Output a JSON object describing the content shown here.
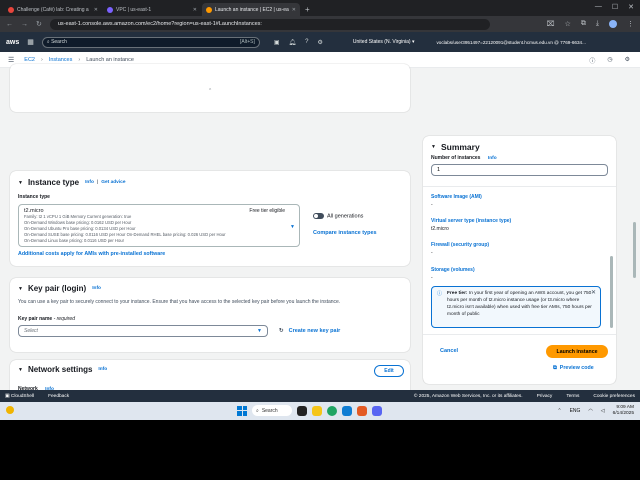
{
  "browser": {
    "tabs": [
      {
        "title": "Challenge (Café) lab: Creating a",
        "color": "#e8453c",
        "active": false
      },
      {
        "title": "VPC | us-east-1",
        "color": "#7b61ff",
        "active": false
      },
      {
        "title": "Launch an instance | EC2 | us-ea",
        "color": "#ff9900",
        "active": true
      }
    ],
    "url": "us-east-1.console.aws.amazon.com/ec2/home?region=us-east-1#LaunchInstances:"
  },
  "aws": {
    "logo": "aws",
    "search_placeholder": "Search",
    "search_shortcut": "[Alt+S]",
    "region": "United States (N. Virginia) ▾",
    "account": "voclabs/user3951497=22120091@student.hcmus.edu.vn @ 7769-6634..."
  },
  "breadcrumb": {
    "items": [
      "EC2",
      "Instances",
      "Launch an instance"
    ]
  },
  "instance_type": {
    "title": "Instance type",
    "info": "Info",
    "get_advice": "Get advice",
    "label": "Instance type",
    "selected": "t2.micro",
    "free_tier": "Free tier eligible",
    "details": [
      "Family: t2     1 vCPU     1 GiB Memory     Current generation: true",
      "On-Demand Windows base pricing: 0.0162 USD per Hour",
      "On-Demand Ubuntu Pro base pricing: 0.0134 USD per Hour",
      "On-Demand SUSE base pricing: 0.0116 USD per Hour     On-Demand RHEL base pricing: 0.026 USD per Hour",
      "On-Demand Linux base pricing: 0.0116 USD per Hour"
    ],
    "all_generations": "All generations",
    "compare": "Compare instance types",
    "additional_costs": "Additional costs apply for AMIs with pre-installed software"
  },
  "key_pair": {
    "title": "Key pair (login)",
    "info": "Info",
    "description": "You can use a key pair to securely connect to your instance. Ensure that you have access to the selected key pair before you launch the instance.",
    "name_label": "Key pair name",
    "required": " - required",
    "placeholder": "Select",
    "create_new": "Create new key pair"
  },
  "network": {
    "title": "Network settings",
    "info": "Info",
    "edit": "Edit",
    "network_label": "Network",
    "network_info": "Info"
  },
  "summary": {
    "title": "Summary",
    "count_label": "Number of instances",
    "count_info": "Info",
    "count_value": "1",
    "software_image": "Software Image (AMI)",
    "software_image_value": "-",
    "server_type": "Virtual server type (instance type)",
    "server_type_value": "t2.micro",
    "firewall": "Firewall (security group)",
    "firewall_value": "-",
    "storage": "Storage (volumes)",
    "storage_value": "-",
    "free_tier_bold": "Free tier:",
    "free_tier_text": " In your first year of opening an AWS account, you get 750 hours per month of t2.micro instance usage (or t3.micro where t2.micro isn't available) when used with free tier AMIs, 750 hours per month of public",
    "cancel": "Cancel",
    "launch": "Launch instance",
    "preview": "Preview code"
  },
  "footer": {
    "cloudshell": "CloudShell",
    "feedback": "Feedback",
    "copyright": "© 2025, Amazon Web Services, Inc. or its affiliates.",
    "privacy": "Privacy",
    "terms": "Terms",
    "cookies": "Cookie preferences"
  },
  "taskbar": {
    "search": "Search",
    "lang": "ENG",
    "time": "9:09 AM",
    "date": "6/14/2025"
  },
  "colors": {
    "aws_nav": "#232f3e",
    "link": "#0972d3",
    "primary": "#ff9900"
  }
}
